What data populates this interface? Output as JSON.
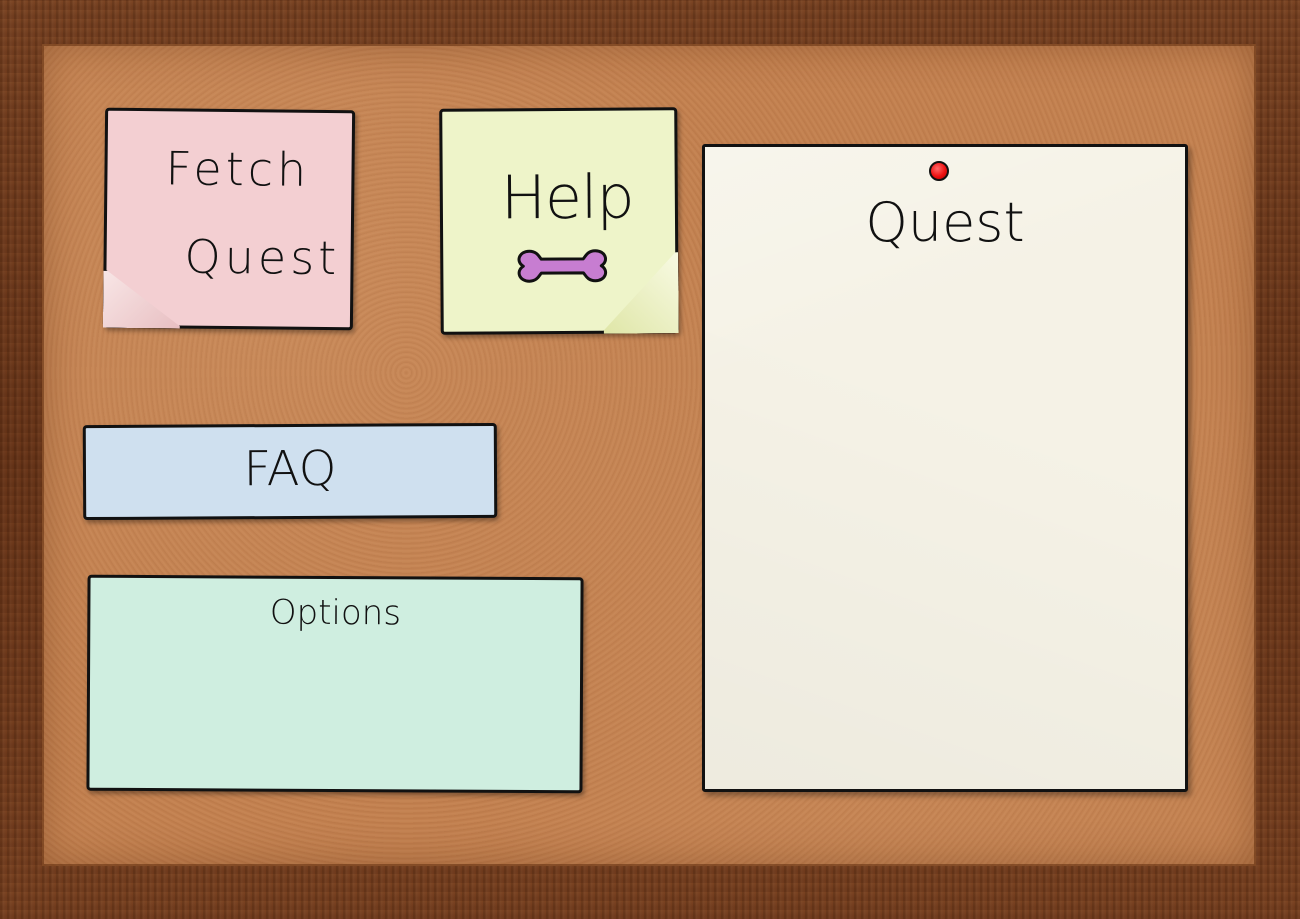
{
  "board": {
    "title_note": {
      "line1": "Fetch",
      "line2": "Quest"
    },
    "help_note": {
      "label": "Help",
      "icon": "bone-icon",
      "icon_color": "#c77dd1"
    },
    "faq_note": {
      "label": "FAQ"
    },
    "options_note": {
      "label": "Options"
    },
    "quest_paper": {
      "label": "Quest",
      "pin_color": "#e11111"
    }
  },
  "colors": {
    "frame": "#6e3a1a",
    "cork": "#c2804f",
    "title_note": "#f3cfd2",
    "help_note": "#eef4c9",
    "faq_note": "#cfe0ef",
    "options_note": "#cfeee0",
    "quest_paper": "#f5f2e6"
  }
}
